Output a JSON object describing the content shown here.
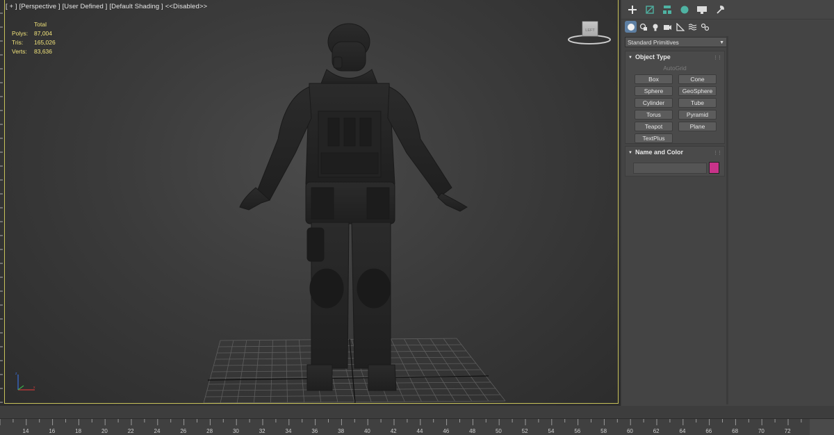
{
  "viewport": {
    "label_parts": [
      "[ + ]",
      "[Perspective ]",
      "[User Defined ]",
      "[Default Shading ]",
      "<<Disabled>>"
    ],
    "stats": {
      "header": "Total",
      "rows": [
        {
          "label": "Polys:",
          "value": "87,004"
        },
        {
          "label": "Tris:",
          "value": "165,026"
        },
        {
          "label": "Verts:",
          "value": "83,636"
        }
      ]
    },
    "viewcube_face": "LEFT",
    "border_color": "#c8c25a"
  },
  "command_panel": {
    "tabs": [
      "create-icon",
      "modify-icon",
      "hierarchy-icon",
      "motion-icon",
      "display-icon",
      "utilities-icon"
    ],
    "subtabs": [
      "geometry-icon",
      "shapes-icon",
      "lights-icon",
      "cameras-icon",
      "helpers-icon",
      "spacewarps-icon",
      "systems-icon"
    ],
    "category_dropdown": "Standard Primitives",
    "object_type": {
      "title": "Object Type",
      "autogrid": "AutoGrid",
      "buttons": [
        "Box",
        "Cone",
        "Sphere",
        "GeoSphere",
        "Cylinder",
        "Tube",
        "Torus",
        "Pyramid",
        "Teapot",
        "Plane",
        "TextPlus"
      ]
    },
    "name_and_color": {
      "title": "Name and Color",
      "name_value": "",
      "color": "#c8338a"
    }
  },
  "timeline": {
    "ticks": [
      "14",
      "16",
      "18",
      "20",
      "22",
      "24",
      "26",
      "28",
      "30",
      "32",
      "34",
      "36",
      "38",
      "40",
      "42",
      "44",
      "46",
      "48",
      "50",
      "52",
      "54",
      "56",
      "58",
      "60",
      "62",
      "64",
      "66",
      "68",
      "70",
      "72"
    ]
  }
}
